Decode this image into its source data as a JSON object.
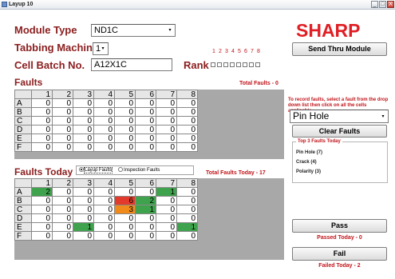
{
  "window": {
    "title": "Layup 10",
    "minimize": "_",
    "maximize": "□",
    "close": "X"
  },
  "form": {
    "module_type_label": "Module Type",
    "module_type_value": "ND1C",
    "tabbing_label": "Tabbing Machine",
    "tabbing_value": "1",
    "cell_batch_label": "Cell Batch No.",
    "cell_batch_value": "A12X1C",
    "rank_label": "Rank",
    "rank_numbers": [
      "1",
      "2",
      "3",
      "4",
      "5",
      "6",
      "7",
      "8"
    ],
    "rank_checked": [
      false,
      false,
      false,
      true,
      false,
      false,
      false,
      false
    ]
  },
  "faults": {
    "title": "Faults",
    "total_text": "Total Faults - 0",
    "columns": [
      "1",
      "2",
      "3",
      "4",
      "5",
      "6",
      "7",
      "8"
    ],
    "rows": [
      {
        "label": "A",
        "values": [
          "0",
          "0",
          "0",
          "0",
          "0",
          "0",
          "0",
          "0"
        ]
      },
      {
        "label": "B",
        "values": [
          "0",
          "0",
          "0",
          "0",
          "0",
          "0",
          "0",
          "0"
        ]
      },
      {
        "label": "C",
        "values": [
          "0",
          "0",
          "0",
          "0",
          "0",
          "0",
          "0",
          "0"
        ]
      },
      {
        "label": "D",
        "values": [
          "0",
          "0",
          "0",
          "0",
          "0",
          "0",
          "0",
          "0"
        ]
      },
      {
        "label": "E",
        "values": [
          "0",
          "0",
          "0",
          "0",
          "0",
          "0",
          "0",
          "0"
        ]
      },
      {
        "label": "F",
        "values": [
          "0",
          "0",
          "0",
          "0",
          "0",
          "0",
          "0",
          "0"
        ]
      }
    ]
  },
  "faults_today": {
    "title": "Faults Today",
    "radio_layup": "Layup Faults",
    "radio_inspection": "Inspection Faults",
    "selected": "layup",
    "total_text": "Total Faults Today - 17",
    "columns": [
      "1",
      "2",
      "3",
      "4",
      "5",
      "6",
      "7",
      "8"
    ],
    "rows": [
      {
        "label": "A",
        "values": [
          "2",
          "0",
          "0",
          "0",
          "0",
          "0",
          "1",
          "0"
        ],
        "colors": [
          "green",
          "",
          "",
          "",
          "",
          "",
          "green",
          ""
        ]
      },
      {
        "label": "B",
        "values": [
          "0",
          "0",
          "0",
          "0",
          "6",
          "2",
          "0",
          "0"
        ],
        "colors": [
          "",
          "",
          "",
          "",
          "red",
          "green",
          "",
          ""
        ]
      },
      {
        "label": "C",
        "values": [
          "0",
          "0",
          "0",
          "0",
          "3",
          "1",
          "0",
          "0"
        ],
        "colors": [
          "",
          "",
          "",
          "",
          "orange",
          "green",
          "",
          ""
        ]
      },
      {
        "label": "D",
        "values": [
          "0",
          "0",
          "0",
          "0",
          "0",
          "0",
          "0",
          "0"
        ],
        "colors": [
          "",
          "",
          "",
          "",
          "",
          "",
          "",
          ""
        ]
      },
      {
        "label": "E",
        "values": [
          "0",
          "0",
          "1",
          "0",
          "0",
          "0",
          "0",
          "1"
        ],
        "colors": [
          "",
          "",
          "green",
          "",
          "",
          "",
          "",
          "green"
        ]
      },
      {
        "label": "F",
        "values": [
          "0",
          "0",
          "0",
          "0",
          "0",
          "0",
          "0",
          "0"
        ],
        "colors": [
          "",
          "",
          "",
          "",
          "",
          "",
          "",
          ""
        ]
      }
    ]
  },
  "right": {
    "logo": "SHARP",
    "send_button": "Send Thru Module",
    "hint": "To record faults, select a fault from the drop down list then click on all the cells applicable.",
    "fault_select": "Pin Hole",
    "clear_button": "Clear Faults",
    "top3_legend": "Top 3 Faults Today",
    "top3": [
      "Pin Hole (7)",
      "Crack (4)",
      "Polarity (3)"
    ],
    "pass_button": "Pass",
    "passed_today": "Passed Today - 0",
    "fail_button": "Fail",
    "failed_today": "Failed Today - 2"
  },
  "colors": {
    "accent": "#8b1e1e",
    "alert": "#c0141a",
    "green": "#3fa34d",
    "red": "#e23b2c",
    "orange": "#f08a1a"
  }
}
